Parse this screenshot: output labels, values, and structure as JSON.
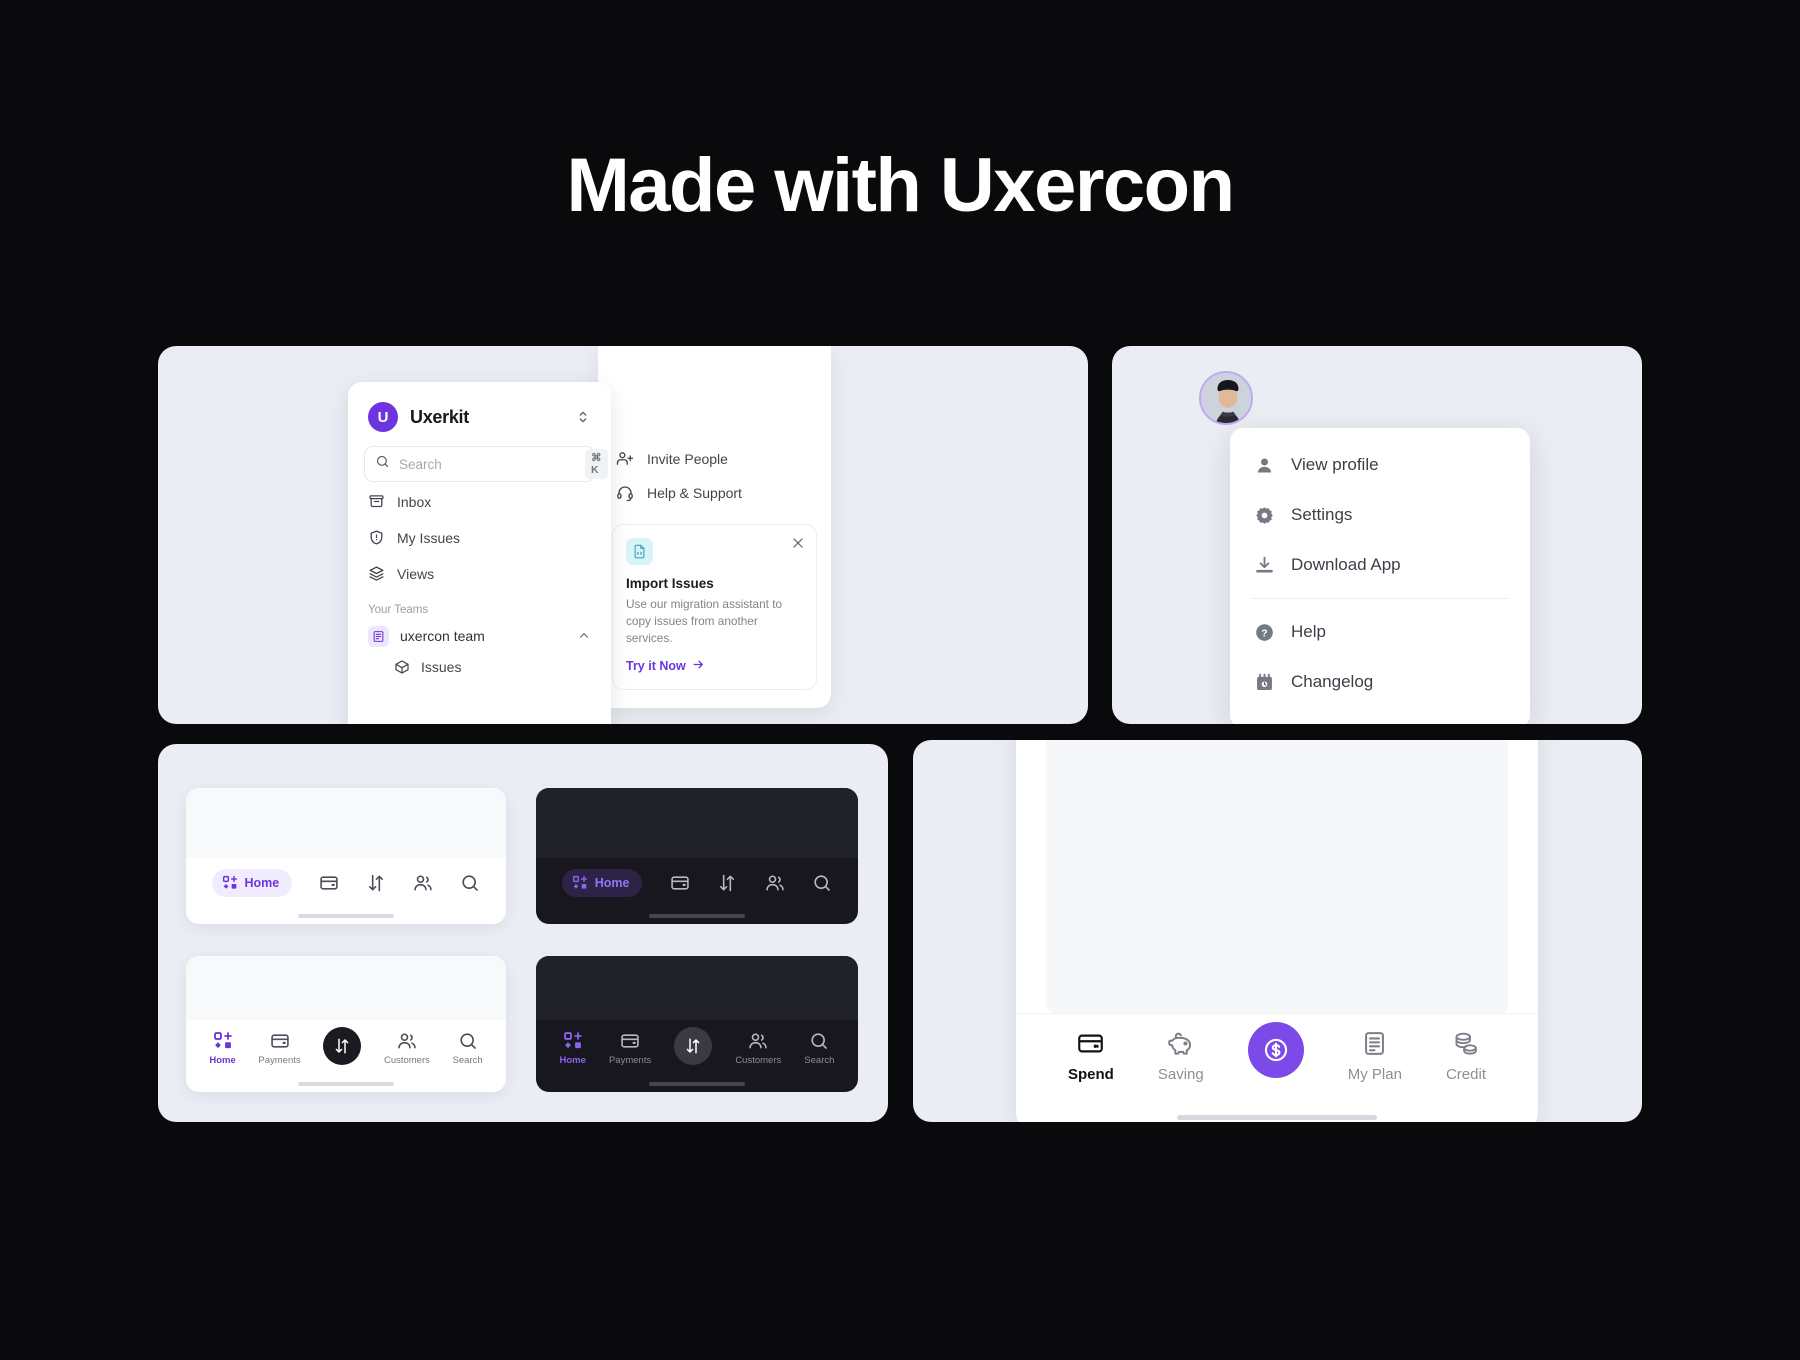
{
  "header": {
    "title": "Made with Uxercon"
  },
  "theme": {
    "background": "#0a0a0c",
    "panel_bg": "#ebedf4",
    "accent_purple": "#6d35e0",
    "accent_purple_light": "#8b63ef",
    "fab_purple": "#7b4ae8",
    "dark_surface": "#17171d"
  },
  "sidebar": {
    "brand": "Uxerkit",
    "brand_initial": "U",
    "switcher_icon": "chevron-up-down-icon",
    "search": {
      "placeholder": "Search",
      "value": "",
      "shortcut": "⌘ K",
      "icon": "search-icon"
    },
    "items": [
      {
        "label": "Inbox",
        "icon": "inbox-icon"
      },
      {
        "label": "My Issues",
        "icon": "shield-alert-icon"
      },
      {
        "label": "Views",
        "icon": "layers-icon"
      }
    ],
    "section_label": "Your Teams",
    "team": {
      "name": "uxercon team",
      "icon": "team-badge-icon",
      "chevron": "chevron-up-icon"
    },
    "team_children": [
      {
        "label": "Issues",
        "icon": "box-icon"
      }
    ]
  },
  "middle_panel": {
    "items": [
      {
        "label": "Invite People",
        "icon": "user-plus-icon"
      },
      {
        "label": "Help & Support",
        "icon": "headset-icon"
      }
    ],
    "promo": {
      "icon": "file-code-icon",
      "close_icon": "close-icon",
      "title": "Import Issues",
      "description": "Use our migration assistant to copy issues from another services.",
      "cta": "Try it Now",
      "cta_arrow": "arrow-right-icon"
    }
  },
  "profile_menu": {
    "avatar": "user-avatar",
    "items": [
      {
        "label": "View profile",
        "icon": "person-icon"
      },
      {
        "label": "Settings",
        "icon": "gear-icon"
      },
      {
        "label": "Download App",
        "icon": "download-icon"
      },
      {
        "label": "Help",
        "icon": "question-circle-icon"
      },
      {
        "label": "Changelog",
        "icon": "calendar-clock-icon"
      }
    ],
    "separator_after_index": 2
  },
  "navbars": {
    "compact": {
      "active_pill": {
        "label": "Home",
        "icon": "home-grid-icon"
      },
      "icons": [
        {
          "icon": "card-icon"
        },
        {
          "icon": "transfer-icon"
        },
        {
          "icon": "customers-icon"
        },
        {
          "icon": "search-icon"
        }
      ]
    },
    "labeled": {
      "items": [
        {
          "label": "Home",
          "icon": "home-grid-icon",
          "active": true
        },
        {
          "label": "Payments",
          "icon": "card-icon",
          "active": false
        },
        {
          "label": "Customers",
          "icon": "customers-icon",
          "active": false
        },
        {
          "label": "Search",
          "icon": "search-icon",
          "active": false
        }
      ],
      "fab": {
        "icon": "transfer-icon"
      }
    }
  },
  "finance_bar": {
    "items": [
      {
        "label": "Spend",
        "icon": "card-icon",
        "active": true
      },
      {
        "label": "Saving",
        "icon": "piggy-bank-icon",
        "active": false
      },
      {
        "label": "My Plan",
        "icon": "document-icon",
        "active": false
      },
      {
        "label": "Credit",
        "icon": "coins-icon",
        "active": false
      }
    ],
    "fab": {
      "icon": "dollar-circle-icon"
    }
  }
}
